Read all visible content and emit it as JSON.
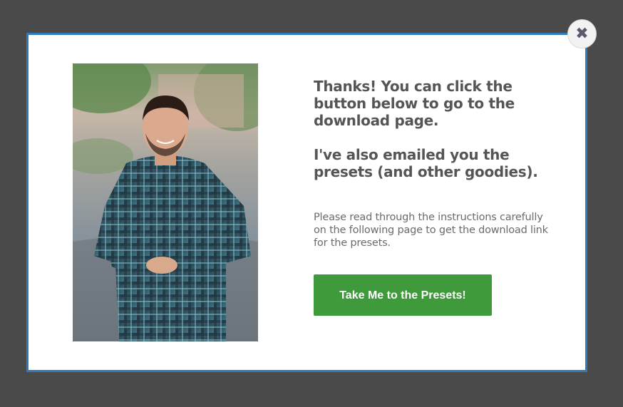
{
  "modal": {
    "headline_1": "Thanks! You can click the button below to go to the download page.",
    "headline_2": "I've also emailed you the presets (and other goodies).",
    "body": "Please read through the instructions carefully on the following page to get the download link for the presets.",
    "cta_label": "Take Me to the Presets!",
    "close_symbol": "✖"
  },
  "colors": {
    "overlay": "#4a4a4a",
    "modal_border": "#2f7bbf",
    "cta_bg": "#3e9a3a",
    "heading_text": "#555555"
  },
  "icons": {
    "close": "close-icon"
  }
}
